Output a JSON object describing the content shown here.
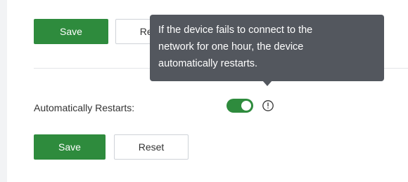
{
  "top_actions": {
    "save_label": "Save",
    "reset_label": "Reset"
  },
  "settings": {
    "auto_restart": {
      "label": "Automatically Restarts:",
      "enabled": true,
      "info_icon": "info-circle-icon"
    }
  },
  "tooltip": {
    "lines": [
      "If the device fails to connect to the",
      "network for one hour, the device",
      "automatically restarts."
    ]
  },
  "bottom_actions": {
    "save_label": "Save",
    "reset_label": "Reset"
  },
  "colors": {
    "primary": "#2e8b3d",
    "tooltip_bg": "#53575e"
  }
}
